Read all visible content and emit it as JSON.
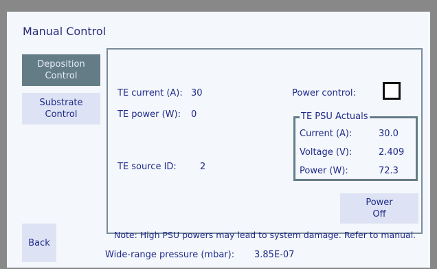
{
  "window": {
    "title": "Manual Control"
  },
  "sidebar": {
    "deposition_label": "Deposition\nControl",
    "substrate_label": "Substrate\nControl",
    "back_label": "Back"
  },
  "panel": {
    "te_current_label": "TE current (A):",
    "te_current_value": "30",
    "te_power_label": "TE power (W):",
    "te_power_value": "0",
    "te_source_label": "TE source ID:",
    "te_source_value": "2",
    "power_control_label": "Power control:",
    "power_control_checked": false,
    "actuals": {
      "title": "TE PSU Actuals",
      "current_label": "Current (A):",
      "current_value": "30.0",
      "voltage_label": "Voltage (V):",
      "voltage_value": "2.409",
      "power_label": "Power (W):",
      "power_value": "72.3"
    },
    "power_off_label": "Power\nOff",
    "note": "Note: High PSU powers may lead to system damage. Refer to manual."
  },
  "footer": {
    "pressure_label": "Wide-range pressure (mbar):",
    "pressure_value": "3.85E-07"
  },
  "colors": {
    "background": "#888888",
    "window": "#f4f7fb",
    "button": "#dde3f4",
    "active_button": "#647c85",
    "text": "#1f2a8a"
  }
}
